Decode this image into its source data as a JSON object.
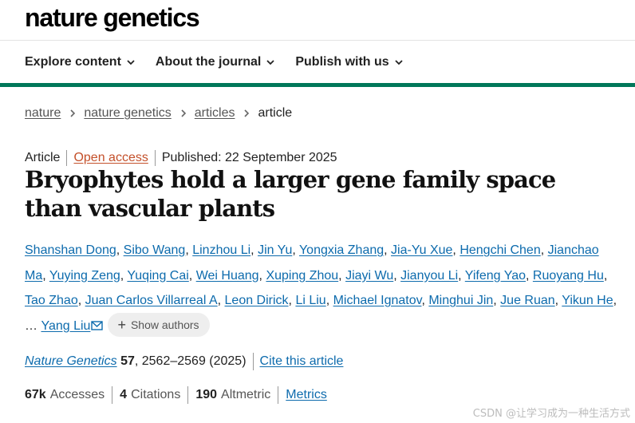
{
  "site": {
    "logo": "nature genetics"
  },
  "nav": {
    "items": [
      {
        "label": "Explore content"
      },
      {
        "label": "About the journal"
      },
      {
        "label": "Publish with us"
      }
    ]
  },
  "breadcrumb": {
    "items": [
      "nature",
      "nature genetics",
      "articles"
    ],
    "current": "article"
  },
  "article": {
    "type": "Article",
    "access": "Open access",
    "published": "Published: 22 September 2025",
    "title": "Bryophytes hold a larger gene family space than vascular plants",
    "authors": [
      "Shanshan Dong",
      "Sibo Wang",
      "Linzhou Li",
      "Jin Yu",
      "Yongxia Zhang",
      "Jia-Yu Xue",
      "Hengchi Chen",
      "Jianchao Ma",
      "Yuying Zeng",
      "Yuqing Cai",
      "Wei Huang",
      "Xuping Zhou",
      "Jiayi Wu",
      "Jianyou Li",
      "Yifeng Yao",
      "Ruoyang Hu",
      "Tao Zhao",
      "Juan Carlos Villarreal A",
      "Leon Dirick",
      "Li Liu",
      "Michael Ignatov",
      "Minghui Jin",
      "Jue Ruan",
      "Yikun He"
    ],
    "ellipsis": "…",
    "last_author": "Yang Liu",
    "show_authors": "Show authors",
    "citation": {
      "journal": "Nature Genetics",
      "volume": "57",
      "rest": ", 2562–2569 (2025)",
      "cite_label": "Cite this article"
    },
    "metrics": {
      "accesses_value": "67k",
      "accesses_label": "Accesses",
      "citations_value": "4",
      "citations_label": "Citations",
      "altmetric_value": "190",
      "altmetric_label": "Altmetric",
      "metrics_link": "Metrics"
    }
  },
  "watermark": "CSDN @让学习成为一种生活方式",
  "colors": {
    "brand_green": "#00785a",
    "link_blue": "#0d6bad",
    "open_access_orange": "#c4502a"
  }
}
